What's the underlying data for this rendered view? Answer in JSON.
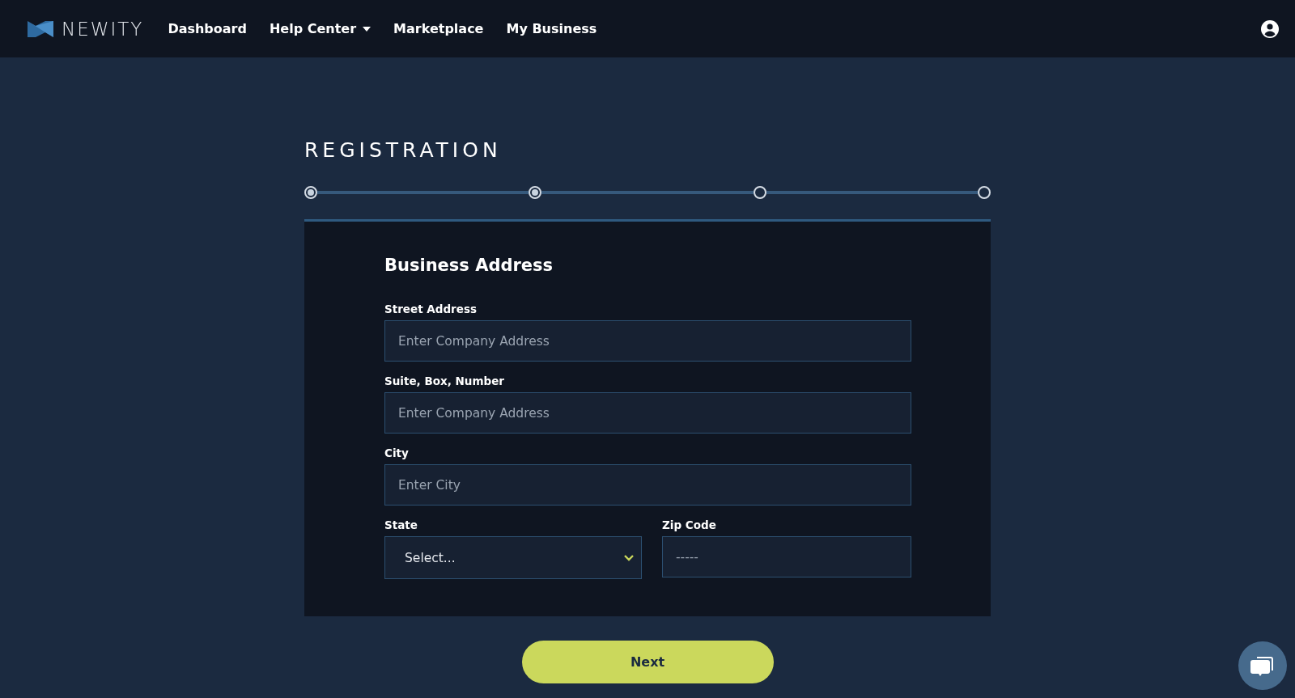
{
  "nav": {
    "brand": "NEWITY",
    "items": [
      {
        "label": "Dashboard",
        "dropdown": false
      },
      {
        "label": "Help Center",
        "dropdown": true
      },
      {
        "label": "Marketplace",
        "dropdown": false
      },
      {
        "label": "My Business",
        "dropdown": false
      }
    ]
  },
  "page_title": "REGISTRATION",
  "steps": [
    {
      "done": true
    },
    {
      "done": true
    },
    {
      "done": false
    },
    {
      "done": false
    }
  ],
  "form": {
    "heading": "Business Address",
    "fields": [
      {
        "kind": "text",
        "label": "Street Address",
        "placeholder": "Enter Company Address"
      },
      {
        "kind": "text",
        "label": "Suite, Box, Number",
        "placeholder": "Enter Company Address"
      },
      {
        "kind": "text",
        "label": "City",
        "placeholder": "Enter City"
      }
    ],
    "row": [
      {
        "kind": "select",
        "label": "State",
        "value": "Select..."
      },
      {
        "kind": "text",
        "label": "Zip Code",
        "placeholder": "-----"
      }
    ]
  },
  "next_button": "Next"
}
